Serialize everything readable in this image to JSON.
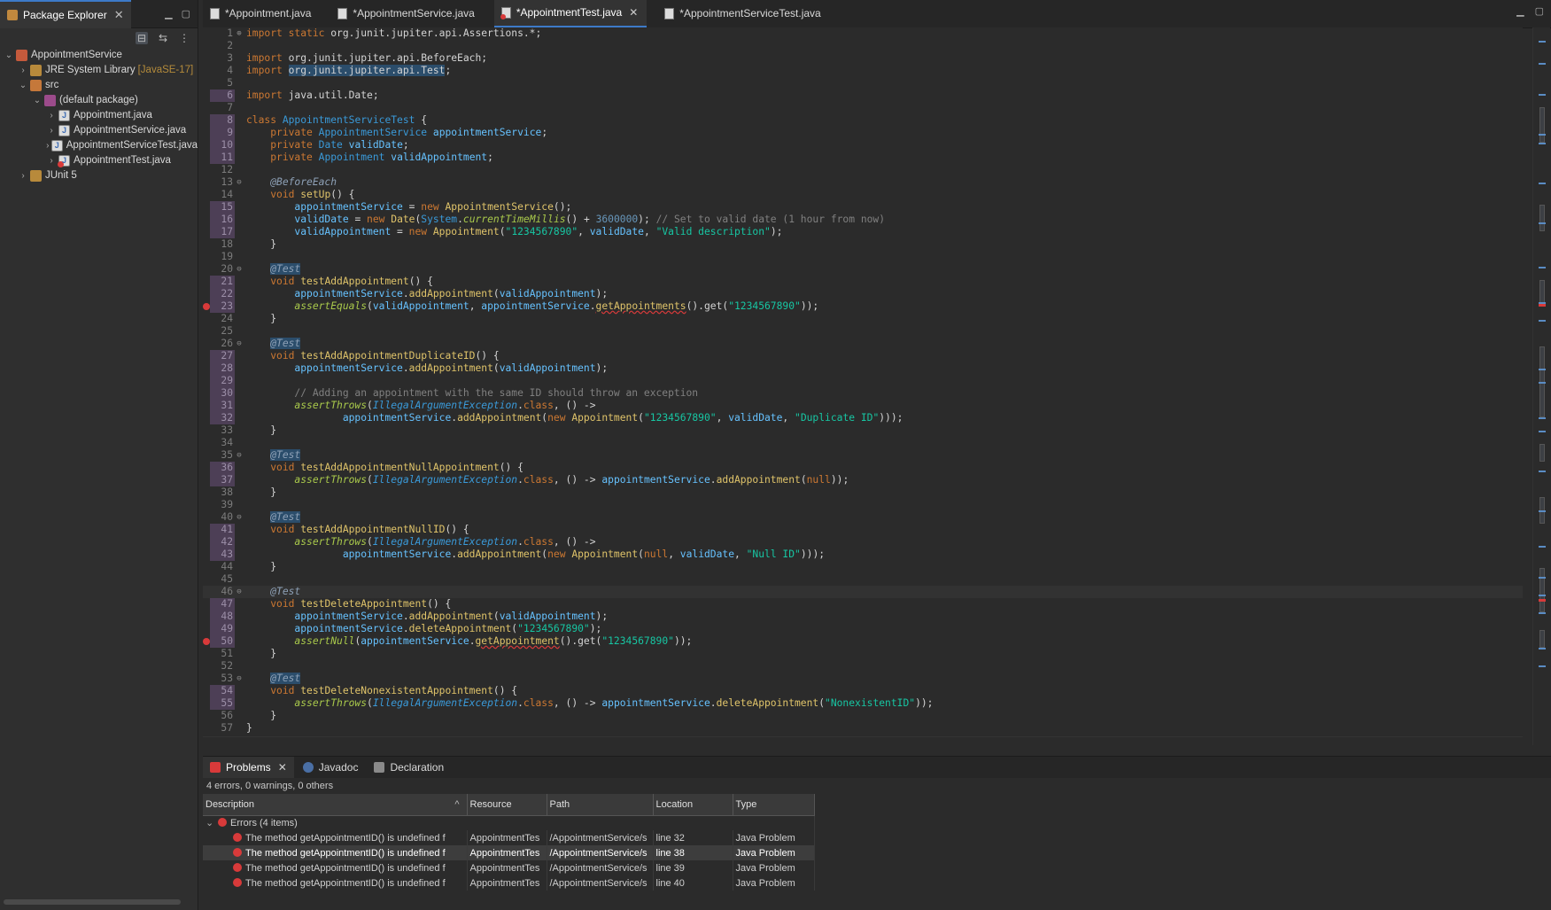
{
  "explorer": {
    "title": "Package Explorer",
    "tree": [
      {
        "label": "AppointmentService",
        "extra": "",
        "depth": 0,
        "twisty": "v",
        "icon": "project"
      },
      {
        "label": "JRE System Library",
        "extra": "[JavaSE-17]",
        "depth": 1,
        "twisty": ">",
        "icon": "library"
      },
      {
        "label": "src",
        "extra": "",
        "depth": 1,
        "twisty": "v",
        "icon": "folder"
      },
      {
        "label": "(default package)",
        "extra": "",
        "depth": 2,
        "twisty": "v",
        "icon": "package"
      },
      {
        "label": "Appointment.java",
        "extra": "",
        "depth": 3,
        "twisty": ">",
        "icon": "java"
      },
      {
        "label": "AppointmentService.java",
        "extra": "",
        "depth": 3,
        "twisty": ">",
        "icon": "java"
      },
      {
        "label": "AppointmentServiceTest.java",
        "extra": "",
        "depth": 3,
        "twisty": ">",
        "icon": "java"
      },
      {
        "label": "AppointmentTest.java",
        "extra": "",
        "depth": 3,
        "twisty": ">",
        "icon": "java-err"
      },
      {
        "label": "JUnit 5",
        "extra": "",
        "depth": 1,
        "twisty": ">",
        "icon": "library"
      }
    ]
  },
  "editor": {
    "tabs": [
      {
        "label": "*Appointment.java",
        "active": false,
        "error": false
      },
      {
        "label": "*AppointmentService.java",
        "active": false,
        "error": false
      },
      {
        "label": "*AppointmentTest.java",
        "active": true,
        "error": true
      },
      {
        "label": "*AppointmentServiceTest.java",
        "active": false,
        "error": false
      }
    ]
  },
  "code": [
    {
      "n": "1",
      "fold": "+",
      "html": "<span class='kw'>import static</span> org.junit.jupiter.api.Assertions.*;"
    },
    {
      "n": "2",
      "html": ""
    },
    {
      "n": "3",
      "html": "<span class='kw'>import</span> org.junit.jupiter.api.BeforeEach;"
    },
    {
      "n": "4",
      "html": "<span class='kw'>import</span> <span class='imp-hl'>org.junit.jupiter.api.Test</span>;"
    },
    {
      "n": "5",
      "html": ""
    },
    {
      "n": "6",
      "ch": true,
      "html": "<span class='kw'>import</span> java.util.Date;"
    },
    {
      "n": "7",
      "html": ""
    },
    {
      "n": "8",
      "ch": true,
      "html": "<span class='kw'>class</span> <span class='ty'>AppointmentServiceTest</span> {"
    },
    {
      "n": "9",
      "ch": true,
      "html": "    <span class='kw'>private</span> <span class='ty'>AppointmentService</span> <span class='fld'>appointmentService</span>;"
    },
    {
      "n": "10",
      "ch": true,
      "html": "    <span class='kw'>private</span> <span class='ty'>Date</span> <span class='fld'>validDate</span>;"
    },
    {
      "n": "11",
      "ch": true,
      "html": "    <span class='kw'>private</span> <span class='ty'>Appointment</span> <span class='fld'>validAppointment</span>;"
    },
    {
      "n": "12",
      "html": ""
    },
    {
      "n": "13",
      "fold": "-",
      "html": "    <span class='ann'>@BeforeEach</span>"
    },
    {
      "n": "14",
      "html": "    <span class='kw'>void</span> <span class='mth'>setUp</span>() {"
    },
    {
      "n": "15",
      "ch": true,
      "html": "        <span class='fld'>appointmentService</span> = <span class='kw'>new</span> <span class='mth'>AppointmentService</span>();"
    },
    {
      "n": "16",
      "ch": true,
      "html": "        <span class='fld'>validDate</span> = <span class='kw'>new</span> <span class='mth'>Date</span>(<span class='ty'>System</span>.<span class='smth'>currentTimeMillis</span>() + <span class='num'>3600000</span>); <span class='cmt'>// Set to valid date (1 hour from now)</span>"
    },
    {
      "n": "17",
      "ch": true,
      "html": "        <span class='fld'>validAppointment</span> = <span class='kw'>new</span> <span class='mth'>Appointment</span>(<span class='str'>\"1234567890\"</span>, <span class='fld'>validDate</span>, <span class='str'>\"Valid description\"</span>);"
    },
    {
      "n": "18",
      "html": "    }"
    },
    {
      "n": "19",
      "html": ""
    },
    {
      "n": "20",
      "fold": "-",
      "html": "    <span class='ann-hl'>@Test</span>"
    },
    {
      "n": "21",
      "ch": true,
      "html": "    <span class='kw'>void</span> <span class='mth'>testAddAppointment</span>() {"
    },
    {
      "n": "22",
      "ch": true,
      "html": "        <span class='fld'>appointmentService</span>.<span class='mth'>addAppointment</span>(<span class='fld'>validAppointment</span>);"
    },
    {
      "n": "23",
      "ch": true,
      "err": true,
      "html": "        <span class='smth'>assertEquals</span>(<span class='fld'>validAppointment</span>, <span class='fld'>appointmentService</span>.<span class='mth sq'>getAppointments</span>().get(<span class='str'>\"1234567890\"</span>));"
    },
    {
      "n": "24",
      "html": "    }"
    },
    {
      "n": "25",
      "html": ""
    },
    {
      "n": "26",
      "fold": "-",
      "html": "    <span class='ann-hl'>@Test</span>"
    },
    {
      "n": "27",
      "ch": true,
      "html": "    <span class='kw'>void</span> <span class='mth'>testAddAppointmentDuplicateID</span>() {"
    },
    {
      "n": "28",
      "ch": true,
      "html": "        <span class='fld'>appointmentService</span>.<span class='mth'>addAppointment</span>(<span class='fld'>validAppointment</span>);"
    },
    {
      "n": "29",
      "ch": true,
      "html": ""
    },
    {
      "n": "30",
      "ch": true,
      "html": "        <span class='cmt'>// Adding an appointment with the same ID should throw an exception</span>"
    },
    {
      "n": "31",
      "ch": true,
      "html": "        <span class='smth'>assertThrows</span>(<span class='cls'>IllegalArgumentException</span>.<span class='kw'>class</span>, () -&gt;"
    },
    {
      "n": "32",
      "ch": true,
      "html": "                <span class='fld'>appointmentService</span>.<span class='mth'>addAppointment</span>(<span class='kw'>new</span> <span class='mth'>Appointment</span>(<span class='str'>\"1234567890\"</span>, <span class='fld'>validDate</span>, <span class='str'>\"Duplicate ID\"</span>)));"
    },
    {
      "n": "33",
      "html": "    }"
    },
    {
      "n": "34",
      "html": ""
    },
    {
      "n": "35",
      "fold": "-",
      "html": "    <span class='ann-hl'>@Test</span>"
    },
    {
      "n": "36",
      "ch": true,
      "html": "    <span class='kw'>void</span> <span class='mth'>testAddAppointmentNullAppointment</span>() {"
    },
    {
      "n": "37",
      "ch": true,
      "html": "        <span class='smth'>assertThrows</span>(<span class='cls'>IllegalArgumentException</span>.<span class='kw'>class</span>, () -&gt; <span class='fld'>appointmentService</span>.<span class='mth'>addAppointment</span>(<span class='lit'>null</span>));"
    },
    {
      "n": "38",
      "html": "    }"
    },
    {
      "n": "39",
      "html": ""
    },
    {
      "n": "40",
      "fold": "-",
      "html": "    <span class='ann-hl'>@Test</span>"
    },
    {
      "n": "41",
      "ch": true,
      "html": "    <span class='kw'>void</span> <span class='mth'>testAddAppointmentNullID</span>() {"
    },
    {
      "n": "42",
      "ch": true,
      "html": "        <span class='smth'>assertThrows</span>(<span class='cls'>IllegalArgumentException</span>.<span class='kw'>class</span>, () -&gt;"
    },
    {
      "n": "43",
      "ch": true,
      "html": "                <span class='fld'>appointmentService</span>.<span class='mth'>addAppointment</span>(<span class='kw'>new</span> <span class='mth'>Appointment</span>(<span class='lit'>null</span>, <span class='fld'>validDate</span>, <span class='str'>\"Null ID\"</span>)));"
    },
    {
      "n": "44",
      "html": "    }"
    },
    {
      "n": "45",
      "html": ""
    },
    {
      "n": "46",
      "fold": "-",
      "cur": true,
      "html": "    <span class='ann'>@Test</span>"
    },
    {
      "n": "47",
      "ch": true,
      "html": "    <span class='kw'>void</span> <span class='mth'>testDeleteAppointment</span>() {"
    },
    {
      "n": "48",
      "ch": true,
      "html": "        <span class='fld'>appointmentService</span>.<span class='mth'>addAppointment</span>(<span class='fld'>validAppointment</span>);"
    },
    {
      "n": "49",
      "ch": true,
      "html": "        <span class='fld'>appointmentService</span>.<span class='mth'>deleteAppointment</span>(<span class='str'>\"1234567890\"</span>);"
    },
    {
      "n": "50",
      "ch": true,
      "err": true,
      "html": "        <span class='smth'>assertNull</span>(<span class='fld'>appointmentService</span>.<span class='mth sq'>getAppointment</span>().get(<span class='str'>\"1234567890\"</span>));"
    },
    {
      "n": "51",
      "html": "    }"
    },
    {
      "n": "52",
      "html": ""
    },
    {
      "n": "53",
      "fold": "-",
      "html": "    <span class='ann-hl'>@Test</span>"
    },
    {
      "n": "54",
      "ch": true,
      "html": "    <span class='kw'>void</span> <span class='mth'>testDeleteNonexistentAppointment</span>() {"
    },
    {
      "n": "55",
      "ch": true,
      "html": "        <span class='smth'>assertThrows</span>(<span class='cls'>IllegalArgumentException</span>.<span class='kw'>class</span>, () -&gt; <span class='fld'>appointmentService</span>.<span class='mth'>deleteAppointment</span>(<span class='str'>\"NonexistentID\"</span>));"
    },
    {
      "n": "56",
      "html": "    }"
    },
    {
      "n": "57",
      "html": "}"
    }
  ],
  "problems": {
    "tabs": [
      {
        "label": "Problems",
        "active": true,
        "icon": "problems"
      },
      {
        "label": "Javadoc",
        "active": false,
        "icon": "javadoc"
      },
      {
        "label": "Declaration",
        "active": false,
        "icon": "decl"
      }
    ],
    "summary": "4 errors, 0 warnings, 0 others",
    "columns": {
      "description": "Description",
      "resource": "Resource",
      "path": "Path",
      "location": "Location",
      "type": "Type"
    },
    "group_label": "Errors (4 items)",
    "rows": [
      {
        "description": "The method getAppointmentID() is undefined f",
        "resource": "AppointmentTes",
        "path": "/AppointmentService/s",
        "location": "line 32",
        "type": "Java Problem",
        "selected": false
      },
      {
        "description": "The method getAppointmentID() is undefined f",
        "resource": "AppointmentTes",
        "path": "/AppointmentService/s",
        "location": "line 38",
        "type": "Java Problem",
        "selected": true
      },
      {
        "description": "The method getAppointmentID() is undefined f",
        "resource": "AppointmentTes",
        "path": "/AppointmentService/s",
        "location": "line 39",
        "type": "Java Problem",
        "selected": false
      },
      {
        "description": "The method getAppointmentID() is undefined f",
        "resource": "AppointmentTes",
        "path": "/AppointmentService/s",
        "location": "line 40",
        "type": "Java Problem",
        "selected": false
      }
    ]
  }
}
